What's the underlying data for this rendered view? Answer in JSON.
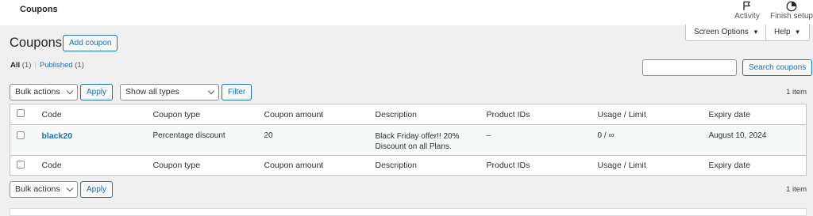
{
  "topbar": {
    "title": "Coupons",
    "activity_label": "Activity",
    "activity_icon": "flag-icon",
    "finish_setup_label": "Finish setup",
    "finish_setup_icon": "progress-circle-icon"
  },
  "screen_meta": {
    "screen_options_label": "Screen Options",
    "help_label": "Help",
    "caret": "▼"
  },
  "header": {
    "page_title": "Coupons",
    "add_coupon_label": "Add coupon"
  },
  "views": [
    {
      "label": "All",
      "count": "(1)"
    },
    {
      "label": "Published",
      "count": "(1)"
    }
  ],
  "views_separator": "|",
  "search": {
    "value": "",
    "button_label": "Search coupons"
  },
  "top_nav": {
    "bulk_actions": "Bulk actions",
    "apply_label": "Apply",
    "type_filter": "Show all types",
    "filter_label": "Filter",
    "items_count": "1 item"
  },
  "table": {
    "columns": [
      "Code",
      "Coupon type",
      "Coupon amount",
      "Description",
      "Product IDs",
      "Usage / Limit",
      "Expiry date"
    ],
    "rows": [
      {
        "code": "black20",
        "type": "Percentage discount",
        "amount": "20",
        "description": "Black Friday offer!! 20% Discount on all Plans.",
        "product_ids": "–",
        "usage_limit": "0 / ∞",
        "expiry": "August 10, 2024"
      }
    ]
  },
  "bottom_nav": {
    "bulk_actions": "Bulk actions",
    "apply_label": "Apply",
    "items_count": "1 item"
  },
  "colors": {
    "accent": "#2271b1",
    "background": "#f0f0f1",
    "text": "#1d2327"
  }
}
